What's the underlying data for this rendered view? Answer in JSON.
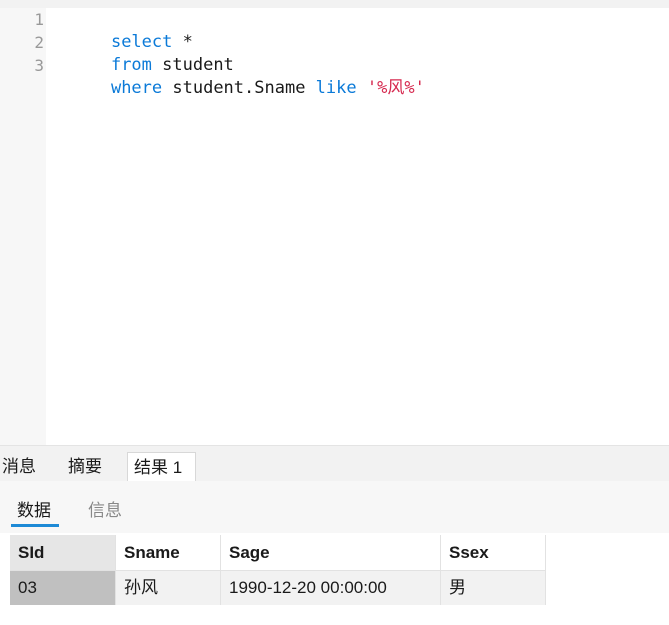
{
  "editor": {
    "line_numbers": [
      "1",
      "2",
      "3"
    ],
    "lines": [
      [
        {
          "t": "kw",
          "v": "select"
        },
        {
          "t": "txt",
          "v": " *"
        }
      ],
      [
        {
          "t": "kw",
          "v": "from"
        },
        {
          "t": "txt",
          "v": " student"
        }
      ],
      [
        {
          "t": "kw",
          "v": "where"
        },
        {
          "t": "txt",
          "v": " student.Sname "
        },
        {
          "t": "kw",
          "v": "like"
        },
        {
          "t": "txt",
          "v": " "
        },
        {
          "t": "str",
          "v": "'%风%'"
        }
      ]
    ]
  },
  "result_tabs": {
    "messages": "消息",
    "summary": "摘要",
    "result1": "结果 1"
  },
  "sub_tabs": {
    "data": "数据",
    "info": "信息"
  },
  "table": {
    "columns": [
      "SId",
      "Sname",
      "Sage",
      "Ssex"
    ],
    "rows": [
      [
        "03",
        "孙风",
        "1990-12-20 00:00:00",
        "男"
      ]
    ]
  }
}
